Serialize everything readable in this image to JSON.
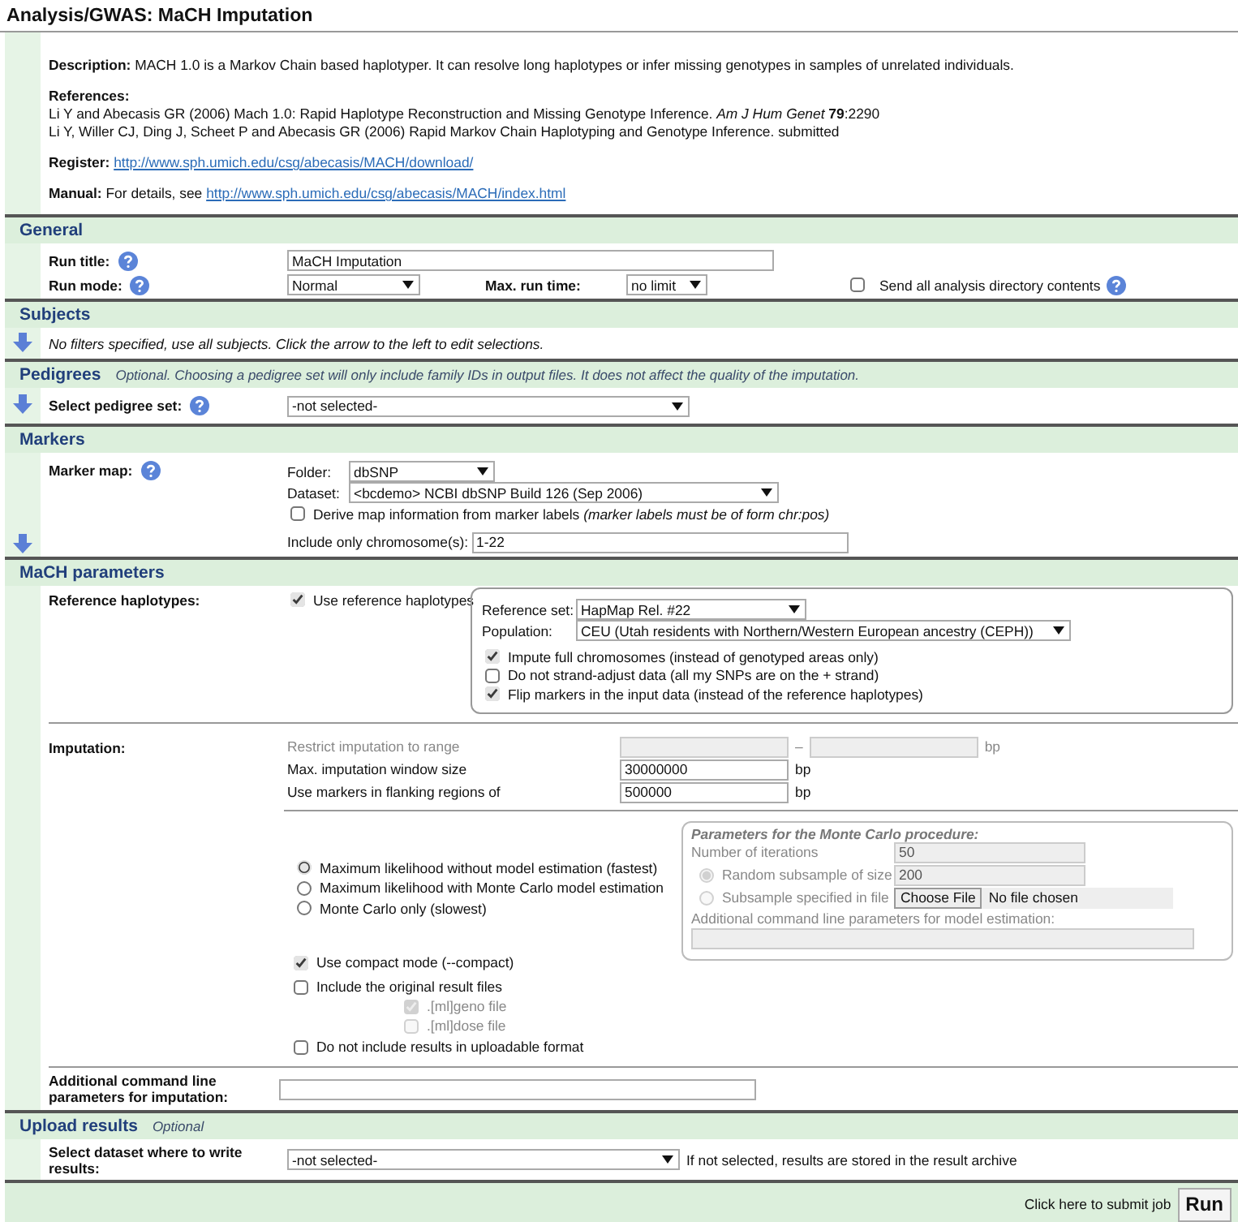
{
  "title": "Analysis/GWAS: MaCH Imputation",
  "description": {
    "label": "Description:",
    "text": "MACH 1.0 is a Markov Chain based haplotyper. It can resolve long haplotypes or infer missing genotypes in samples of unrelated individuals."
  },
  "references": {
    "label": "References:",
    "items": [
      "Li Y and Abecasis GR (2006) Mach 1.0: Rapid Haplotype Reconstruction and Missing Genotype Inference. *Am J Hum Genet* **79**:2290",
      "Li Y, Willer CJ, Ding J, Scheet P and Abecasis GR (2006) Rapid Markov Chain Haplotyping and Genotype Inference. submitted"
    ]
  },
  "register": {
    "label": "Register:",
    "link": "http://www.sph.umich.edu/csg/abecasis/MACH/download/"
  },
  "manual": {
    "label": "Manual:",
    "text": "For details, see",
    "link": "http://www.sph.umich.edu/csg/abecasis/MACH/index.html"
  },
  "general": {
    "heading": "General",
    "run_title": {
      "label": "Run title:",
      "value": "MaCH Imputation"
    },
    "run_mode": {
      "label": "Run mode:",
      "value": "Normal"
    },
    "max_run_time": {
      "label": "Max. run time:",
      "value": "no limit"
    },
    "send_all": {
      "label": "Send all analysis directory contents",
      "checked": false
    }
  },
  "subjects": {
    "heading": "Subjects",
    "note": "No filters specified, use all subjects. Click the arrow to the left to edit selections."
  },
  "pedigrees": {
    "heading": "Pedigrees",
    "subtitle": "Optional. Choosing a pedigree set will only include family IDs in output files. It does not affect the quality of the imputation.",
    "select": {
      "label": "Select pedigree set:",
      "value": "-not selected-"
    }
  },
  "markers": {
    "heading": "Markers",
    "label": "Marker map:",
    "folder": {
      "label": "Folder:",
      "value": "dbSNP"
    },
    "dataset": {
      "label": "Dataset:",
      "value": "<bcdemo> NCBI dbSNP Build 126 (Sep 2006)"
    },
    "derive": {
      "label": "Derive map information from marker labels *(marker labels must be of form chr:pos)*",
      "checked": false
    },
    "chromosomes": {
      "label": "Include only chromosome(s):",
      "value": "1-22"
    }
  },
  "mach": {
    "heading": "MaCH parameters",
    "reference": {
      "label": "Reference haplotypes:",
      "use": {
        "label": "Use reference haplotypes",
        "checked": true
      },
      "reference_set": {
        "label": "Reference set:",
        "value": "HapMap Rel. #22"
      },
      "population": {
        "label": "Population:",
        "value": "CEU (Utah residents with Northern/Western European ancestry (CEPH))"
      },
      "options": [
        {
          "label": "Impute full chromosomes (instead of genotyped areas only)",
          "checked": true
        },
        {
          "label": "Do not strand-adjust data (all my SNPs are on the + strand)",
          "checked": false
        },
        {
          "label": "Flip markers in the input data (instead of the reference haplotypes)",
          "checked": true
        }
      ]
    },
    "imputation": {
      "label": "Imputation:",
      "range": {
        "label": "Restrict imputation to range",
        "separator": "–",
        "unit": "bp",
        "disabled": true
      },
      "window": {
        "label": "Max. imputation window size",
        "value": "30000000",
        "unit": "bp"
      },
      "flanking": {
        "label": "Use markers in flanking regions of",
        "value": "500000",
        "unit": "bp"
      },
      "methods": [
        {
          "label": "Maximum likelihood without model estimation (fastest)",
          "selected": true
        },
        {
          "label": "Maximum likelihood with Monte Carlo model estimation",
          "selected": false
        },
        {
          "label": "Monte Carlo only (slowest)",
          "selected": false
        }
      ],
      "monte_carlo": {
        "title": "Parameters for the Monte Carlo procedure:",
        "disabled": true,
        "iterations": {
          "label": "Number of iterations",
          "value": "50"
        },
        "random": {
          "label": "Random subsample of size",
          "selected": true,
          "value": "200"
        },
        "file": {
          "label": "Subsample specified in file",
          "selected": false,
          "button": "Choose File",
          "status": "No file chosen"
        },
        "additional": {
          "label": "Additional command line parameters for model estimation:"
        }
      },
      "compact": {
        "label": "Use compact mode (--compact)",
        "checked": true
      },
      "include_original": {
        "label": "Include the original result files",
        "checked": false,
        "files": [
          {
            "label": ".[ml]geno file",
            "checked": true,
            "disabled": true
          },
          {
            "label": ".[ml]dose file",
            "checked": false,
            "disabled": true
          }
        ]
      },
      "no_upload": {
        "label": "Do not include results in uploadable format",
        "checked": false
      }
    },
    "additional": {
      "label": "Additional command line parameters for imputation:"
    }
  },
  "upload": {
    "heading": "Upload results",
    "subtitle": "Optional",
    "select": {
      "label": "Select dataset where to write results:",
      "value": "-not selected-"
    },
    "note": "If not selected, results are stored in the result archive"
  },
  "footer": {
    "text": "Click here to submit job",
    "button": "Run"
  }
}
